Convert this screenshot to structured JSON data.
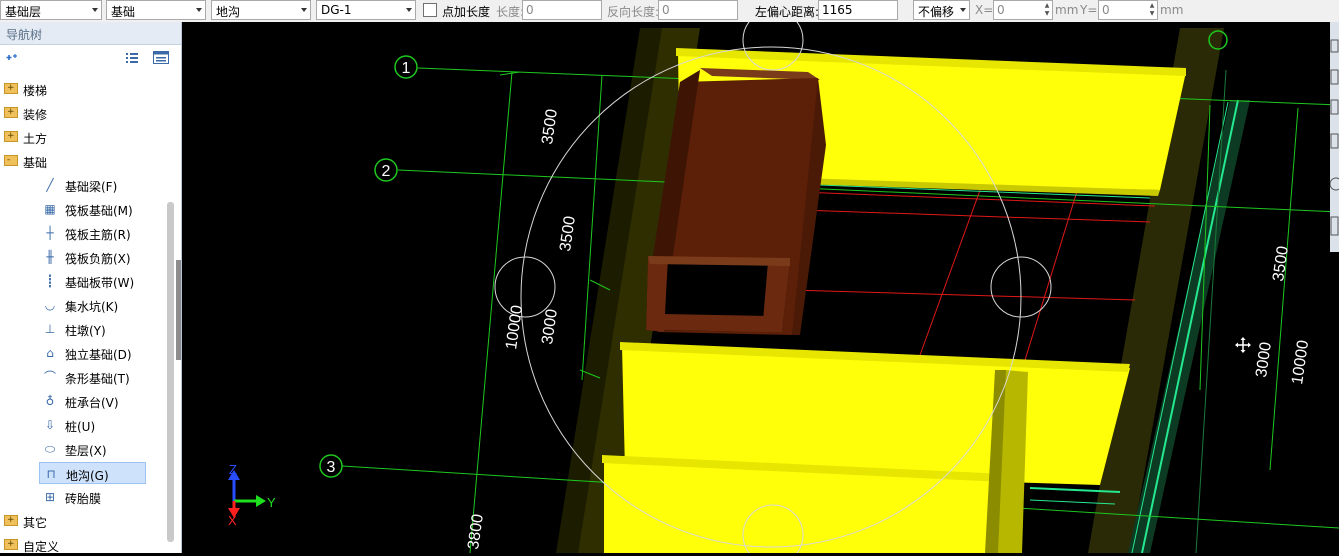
{
  "toolbar": {
    "floor_select": "基础层",
    "category_select": "基础",
    "component_type_select": "地沟",
    "component_name_select": "DG-1",
    "add_length_label": "点加长度",
    "length_label": "长度:",
    "length_value": "0",
    "reverse_length_label": "反向长度:",
    "reverse_length_value": "0",
    "left_offset_label": "左偏心距离:",
    "left_offset_value": "1165",
    "offset_mode_select": "不偏移",
    "x_label": "X=",
    "x_value": "0",
    "x_unit": "mm",
    "y_label": "Y=",
    "y_value": "0",
    "y_unit": "mm"
  },
  "nav": {
    "title": "导航树",
    "tree": [
      {
        "label": "楼梯",
        "type": "folder",
        "state": "+"
      },
      {
        "label": "装修",
        "type": "folder",
        "state": "+"
      },
      {
        "label": "土方",
        "type": "folder",
        "state": "+"
      },
      {
        "label": "基础",
        "type": "folder",
        "state": "-"
      },
      {
        "label": "基础梁(F)",
        "type": "leaf",
        "icon": "beam-icon"
      },
      {
        "label": "筏板基础(M)",
        "type": "leaf",
        "icon": "raft-icon"
      },
      {
        "label": "筏板主筋(R)",
        "type": "leaf",
        "icon": "raft-main-rebar-icon"
      },
      {
        "label": "筏板负筋(X)",
        "type": "leaf",
        "icon": "raft-neg-rebar-icon"
      },
      {
        "label": "基础板带(W)",
        "type": "leaf",
        "icon": "strip-icon"
      },
      {
        "label": "集水坑(K)",
        "type": "leaf",
        "icon": "sump-icon"
      },
      {
        "label": "柱墩(Y)",
        "type": "leaf",
        "icon": "pier-icon"
      },
      {
        "label": "独立基础(D)",
        "type": "leaf",
        "icon": "isolated-footing-icon"
      },
      {
        "label": "条形基础(T)",
        "type": "leaf",
        "icon": "strip-footing-icon"
      },
      {
        "label": "桩承台(V)",
        "type": "leaf",
        "icon": "pile-cap-icon"
      },
      {
        "label": "桩(U)",
        "type": "leaf",
        "icon": "pile-icon"
      },
      {
        "label": "垫层(X)",
        "type": "leaf",
        "icon": "cushion-icon"
      },
      {
        "label": "地沟(G)",
        "type": "leaf",
        "icon": "trench-icon",
        "selected": true
      },
      {
        "label": "砖胎膜",
        "type": "leaf",
        "icon": "brick-form-icon"
      },
      {
        "label": "其它",
        "type": "folder",
        "state": "+"
      },
      {
        "label": "自定义",
        "type": "folder",
        "state": "+"
      }
    ]
  },
  "viewport": {
    "axis_labels": [
      "1",
      "2",
      "3"
    ],
    "dimensions": [
      "3500",
      "3500",
      "3000",
      "10000",
      "3500",
      "3000",
      "10000",
      "3800"
    ],
    "gizmo": {
      "z": "Z",
      "y": "Y",
      "x": "X"
    },
    "colors": {
      "background": "#000000",
      "grid": "#1ec81e",
      "slab": "#ffff0a",
      "trench": "#6b2a10",
      "rebar": "#e01818",
      "edge": "#25e890"
    }
  }
}
